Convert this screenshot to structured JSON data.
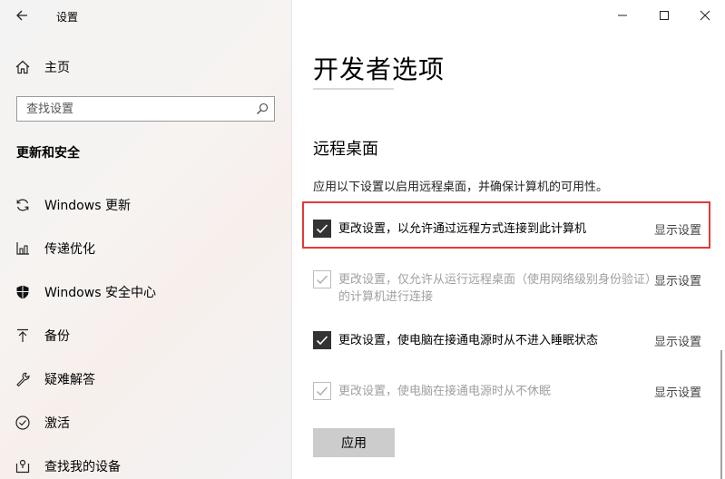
{
  "window": {
    "title": "设置"
  },
  "sidebar": {
    "home_label": "主页",
    "search_placeholder": "查找设置",
    "section_title": "更新和安全",
    "items": [
      {
        "label": "Windows 更新",
        "icon": "sync-icon"
      },
      {
        "label": "传递优化",
        "icon": "delivery-optimization-icon"
      },
      {
        "label": "Windows 安全中心",
        "icon": "shield-icon"
      },
      {
        "label": "备份",
        "icon": "backup-arrow-icon"
      },
      {
        "label": "疑难解答",
        "icon": "wrench-icon"
      },
      {
        "label": "激活",
        "icon": "check-circle-icon"
      },
      {
        "label": "查找我的设备",
        "icon": "find-device-icon"
      }
    ]
  },
  "main": {
    "title": "开发者选项",
    "section": "远程桌面",
    "description": "应用以下设置以启用远程桌面，并确保计算机的可用性。",
    "options": [
      {
        "text": "更改设置，以允许通过远程方式连接到此计算机",
        "checked": true,
        "disabled": false,
        "link": "显示设置"
      },
      {
        "text": "更改设置，仅允许从运行远程桌面（使用网络级别身份验证）的计算机进行连接",
        "checked": true,
        "disabled": true,
        "link": "显示设置"
      },
      {
        "text": "更改设置，使电脑在接通电源时从不进入睡眠状态",
        "checked": true,
        "disabled": false,
        "link": "显示设置"
      },
      {
        "text": "更改设置，使电脑在接通电源时从不休眠",
        "checked": true,
        "disabled": true,
        "link": "显示设置"
      }
    ],
    "apply_label": "应用"
  },
  "colors": {
    "checkbox_checked": "#333333",
    "checkbox_disabled": "#bcbcbc",
    "highlight": "#e53935",
    "button_bg": "#cccccc"
  }
}
